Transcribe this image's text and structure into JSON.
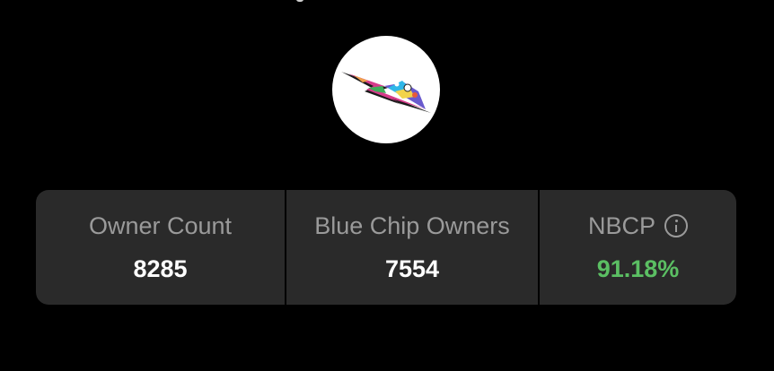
{
  "stats": {
    "owner_count_label": "Owner Count",
    "owner_count_value": "8285",
    "blue_chip_label": "Blue Chip Owners",
    "blue_chip_value": "7554",
    "nbcp_label": "NBCP",
    "nbcp_value": "91.18%"
  },
  "icons": {
    "info": "info-icon",
    "avatar": "collection-logo"
  },
  "colors": {
    "background": "#000000",
    "card": "#2a2a2a",
    "label": "#9a9a9a",
    "value": "#ffffff",
    "positive": "#5bbf63"
  }
}
